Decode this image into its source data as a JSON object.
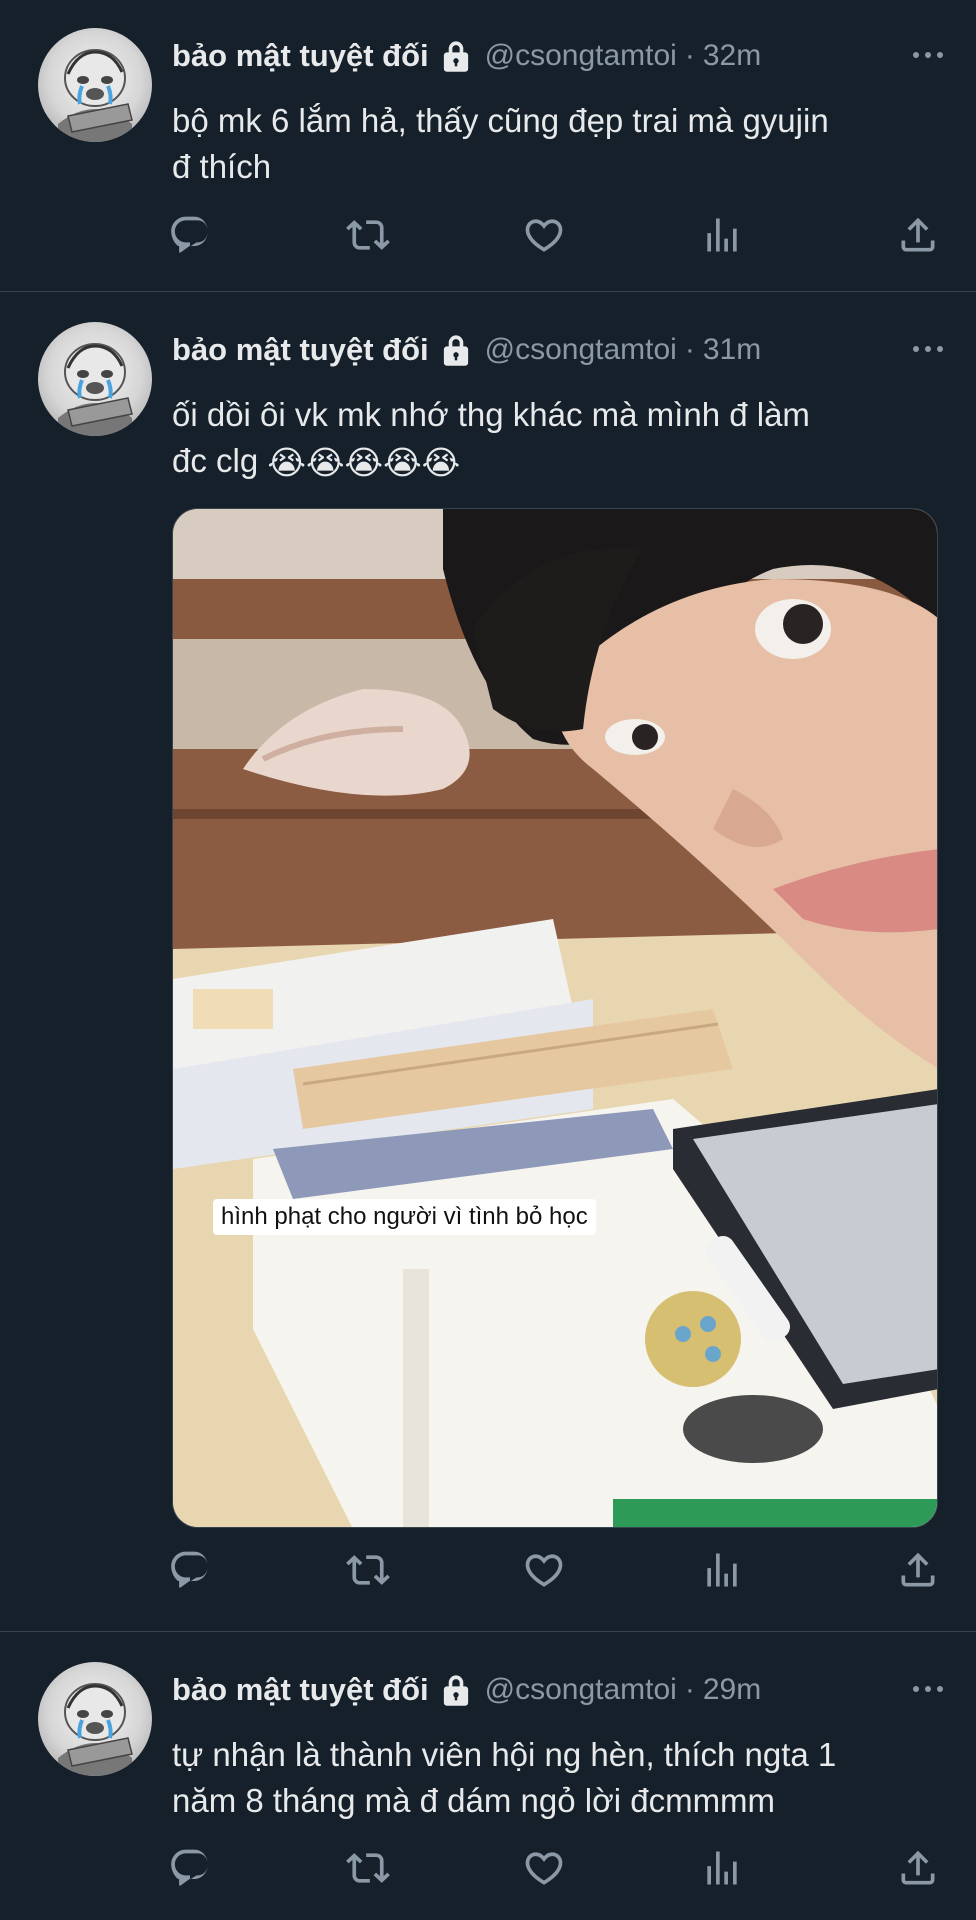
{
  "tweets": [
    {
      "name": "bảo mật tuyệt đối",
      "handle": "@csongtamtoi",
      "separator": "·",
      "time": "32m",
      "text_lines": [
        "bộ mk 6 lắm hả, thấy cũng đẹp trai mà gyujin",
        "đ thích"
      ]
    },
    {
      "name": "bảo mật tuyệt đối",
      "handle": "@csongtamtoi",
      "separator": "·",
      "time": "31m",
      "text_lines": [
        "ối dồi ôi vk mk nhớ thg khác mà mình đ làm",
        "đc clg"
      ],
      "emoji": "😭😭😭😭😭",
      "media_caption": "hình phạt cho người vì tình bỏ học"
    },
    {
      "name": "bảo mật tuyệt đối",
      "handle": "@csongtamtoi",
      "separator": "·",
      "time": "29m",
      "text_lines": [
        "tự nhận là thành viên hội ng hèn, thích ngta 1",
        "năm 8 tháng mà đ dám ngỏ lời đcmmmm"
      ]
    }
  ],
  "icons": {
    "reply": "reply-icon",
    "retweet": "retweet-icon",
    "like": "heart-icon",
    "views": "views-icon",
    "share": "share-icon",
    "more": "more-icon",
    "lock": "lock-icon"
  },
  "colors": {
    "background": "#15202b",
    "text": "#e7e9ea",
    "muted": "#8b98a5",
    "divider": "#38444d"
  }
}
